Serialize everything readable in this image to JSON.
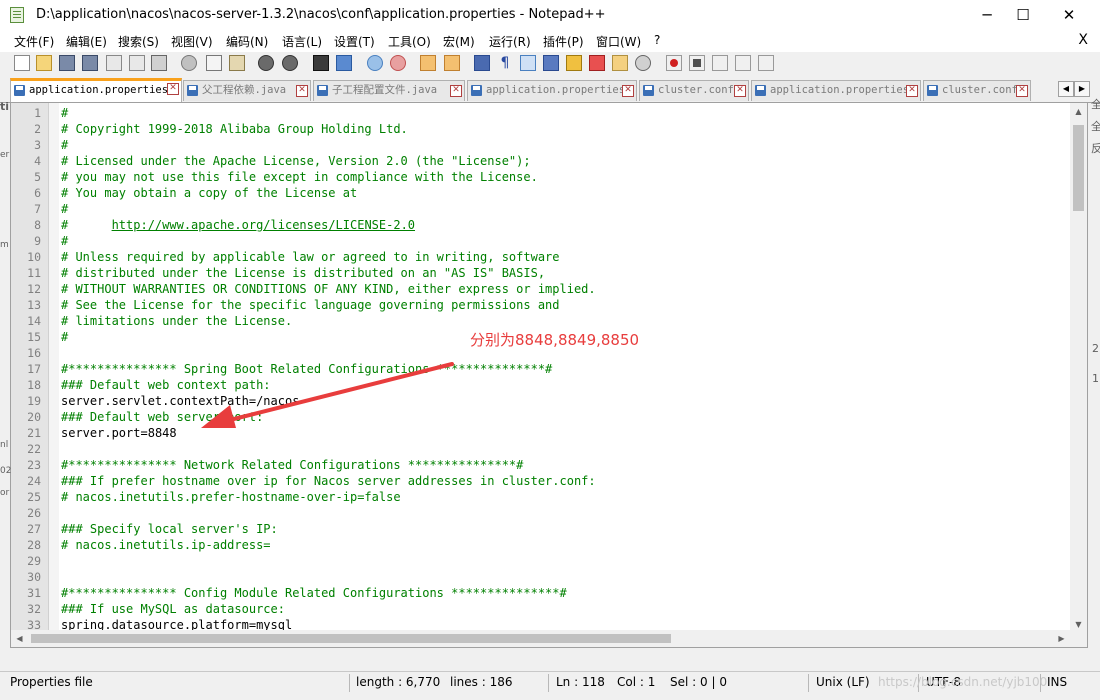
{
  "window": {
    "title": "D:\\application\\nacos\\nacos-server-1.3.2\\nacos\\conf\\application.properties - Notepad++",
    "minimize": "─",
    "maximize": "☐",
    "close": "✕"
  },
  "menu": {
    "items": [
      "文件(F)",
      "编辑(E)",
      "搜索(S)",
      "视图(V)",
      "编码(N)",
      "语言(L)",
      "设置(T)",
      "工具(O)",
      "宏(M)",
      "运行(R)",
      "插件(P)",
      "窗口(W)",
      "?"
    ],
    "close": "X"
  },
  "tabs": [
    {
      "label": "application.properties",
      "active": true
    },
    {
      "label": "父工程依赖.java",
      "active": false
    },
    {
      "label": "子工程配置文件.java",
      "active": false
    },
    {
      "label": "application.properties",
      "active": false
    },
    {
      "label": "cluster.conf",
      "active": false
    },
    {
      "label": "application.properties",
      "active": false
    },
    {
      "label": "cluster.conf",
      "active": false
    }
  ],
  "tab_nav": {
    "left": "◀",
    "right": "▶"
  },
  "editor": {
    "lines": [
      "#",
      "# Copyright 1999-2018 Alibaba Group Holding Ltd.",
      "#",
      "# Licensed under the Apache License, Version 2.0 (the \"License\");",
      "# you may not use this file except in compliance with the License.",
      "# You may obtain a copy of the License at",
      "#",
      "#      http://www.apache.org/licenses/LICENSE-2.0",
      "#",
      "# Unless required by applicable law or agreed to in writing, software",
      "# distributed under the License is distributed on an \"AS IS\" BASIS,",
      "# WITHOUT WARRANTIES OR CONDITIONS OF ANY KIND, either express or implied.",
      "# See the License for the specific language governing permissions and",
      "# limitations under the License.",
      "#",
      "",
      "#*************** Spring Boot Related Configurations ***************#",
      "### Default web context path:",
      "server.servlet.contextPath=/nacos",
      "### Default web server port:",
      "server.port=8848",
      "",
      "#*************** Network Related Configurations ***************#",
      "### If prefer hostname over ip for Nacos server addresses in cluster.conf:",
      "# nacos.inetutils.prefer-hostname-over-ip=false",
      "",
      "### Specify local server's IP:",
      "# nacos.inetutils.ip-address=",
      "",
      "",
      "#*************** Config Module Related Configurations ***************#",
      "### If use MySQL as datasource:",
      "spring.datasource.platform=mysql",
      ""
    ]
  },
  "annotation": {
    "text": "分别为8848,8849,8850"
  },
  "status": {
    "file_type": "Properties file",
    "length": "length : 6,770",
    "lines": "lines : 186",
    "ln": "Ln : 118",
    "col": "Col : 1",
    "sel": "Sel : 0 | 0",
    "eol": "Unix (LF)",
    "encoding": "UTF-8",
    "mode": "INS",
    "watermark": "https://blog.csdn.net/yjb100"
  },
  "side_fragments": {
    "right": [
      "全",
      "全",
      "反",
      "2",
      "1"
    ],
    "left": [
      "ti",
      "er",
      "m",
      "nl",
      "02",
      "or"
    ]
  },
  "colors": {
    "comment": "#008000",
    "accent_tab": "#f9a11b",
    "annotation": "#e83d3d"
  }
}
